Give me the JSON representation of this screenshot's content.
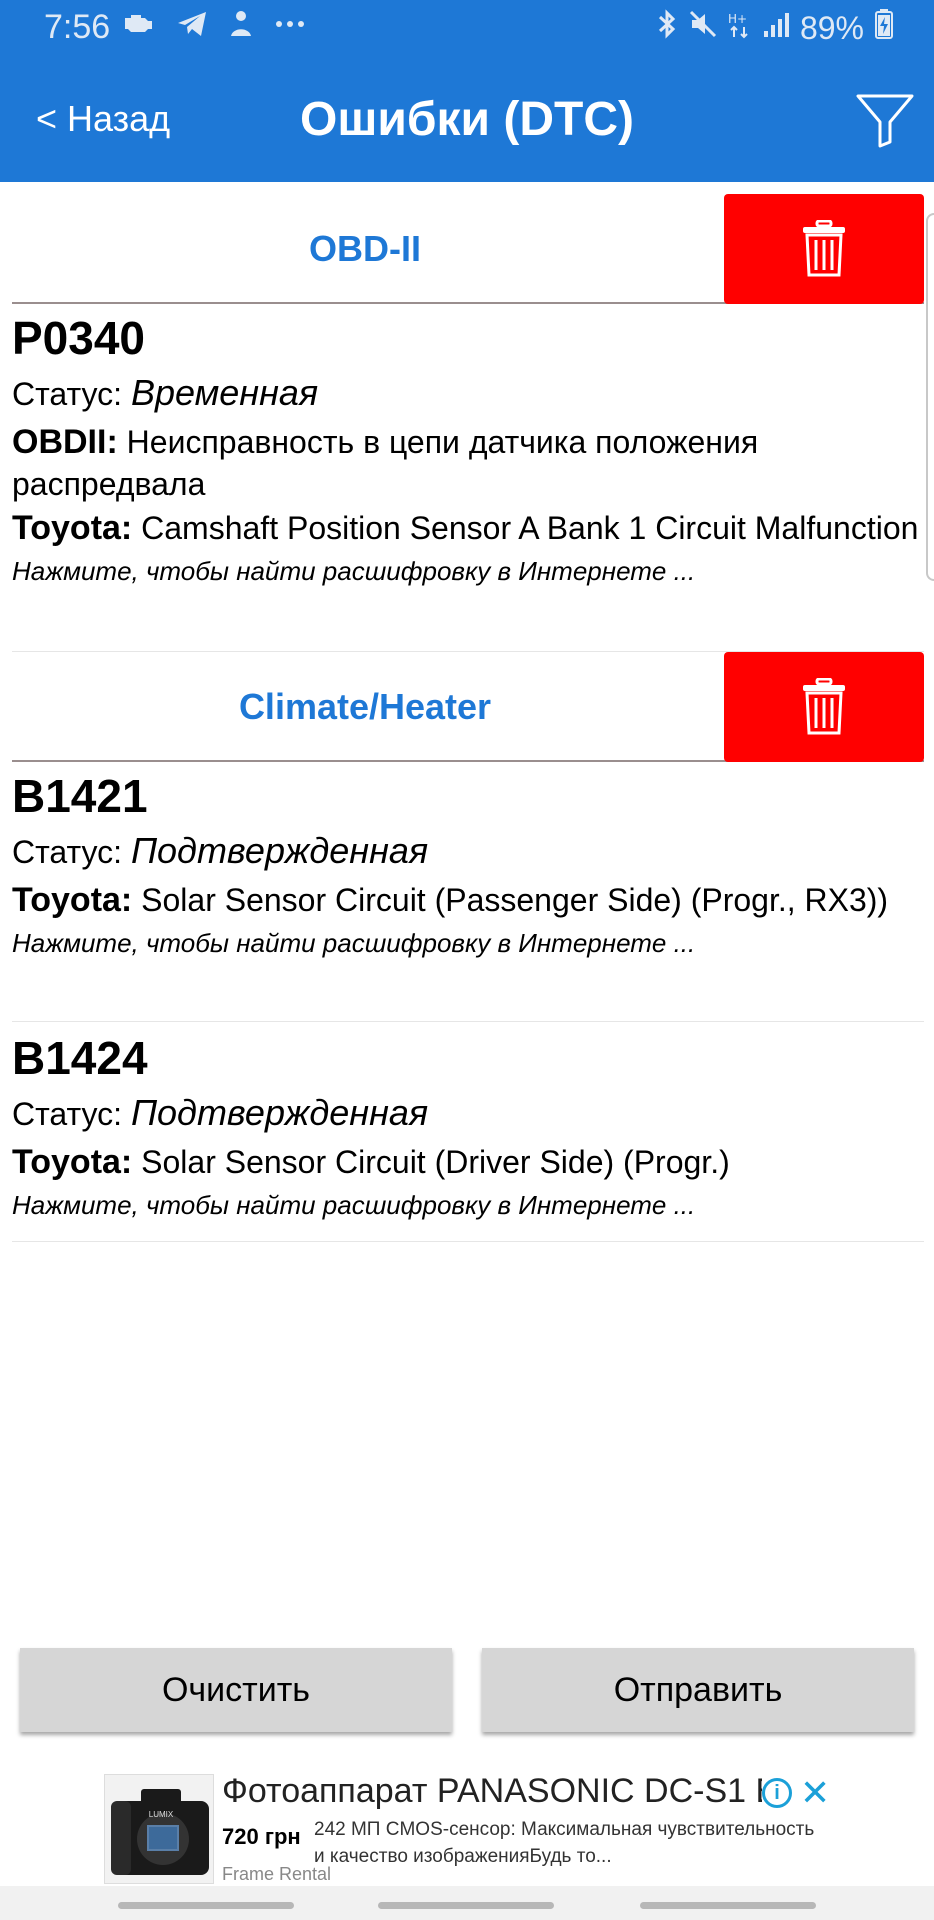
{
  "status_bar": {
    "time": "7:56",
    "left_icons": [
      "engine-icon",
      "telegram-icon",
      "bluetooth-person-icon",
      "more-dots-icon"
    ],
    "right_icons": [
      "bluetooth-icon",
      "mute-icon",
      "data-hplus-icon",
      "signal-icon"
    ],
    "battery": "89%"
  },
  "app_bar": {
    "back_label": "< Назад",
    "title": "Ошибки (DTC)",
    "background": "#1e78d6"
  },
  "groups": [
    {
      "title": "OBD-II",
      "dtcs": [
        {
          "code": "P0340",
          "status_label": "Статус:",
          "status_value": "Временная",
          "descriptions": [
            {
              "source": "OBDII:",
              "text": "Неисправность в цепи датчика положения распредвала"
            },
            {
              "source": "Toyota:",
              "text": "Camshaft Position Sensor A Bank 1 Circuit Malfunction"
            }
          ],
          "hint": "Нажмите, чтобы найти расшифровку в Интернете ..."
        }
      ]
    },
    {
      "title": "Climate/Heater",
      "dtcs": [
        {
          "code": "B1421",
          "status_label": "Статус:",
          "status_value": "Подтвержденная",
          "descriptions": [
            {
              "source": "Toyota:",
              "text": "Solar Sensor Circuit (Passenger Side) (Progr., RX3))"
            }
          ],
          "hint": "Нажмите, чтобы найти расшифровку в Интернете ..."
        },
        {
          "code": "B1424",
          "status_label": "Статус:",
          "status_value": "Подтвержденная",
          "descriptions": [
            {
              "source": "Toyota:",
              "text": "Solar Sensor Circuit (Driver Side) (Progr.)"
            }
          ],
          "hint": "Нажмите, чтобы найти расшифровку в Интернете ..."
        }
      ]
    }
  ],
  "buttons": {
    "clear_label": "Очистить",
    "send_label": "Отправить"
  },
  "ad": {
    "title": "Фотоаппарат PANASONIC DC-S1 E",
    "price": "720 грн",
    "description": "242 МП CMOS-сенсор: Максимальная чувствительность и качество изображенияБудь то...",
    "source": "Frame Rental",
    "image_logo": "LUMIX"
  },
  "colors": {
    "accent": "#1e78d6",
    "delete": "#ff0000",
    "button_gray": "#d6d6d6"
  }
}
